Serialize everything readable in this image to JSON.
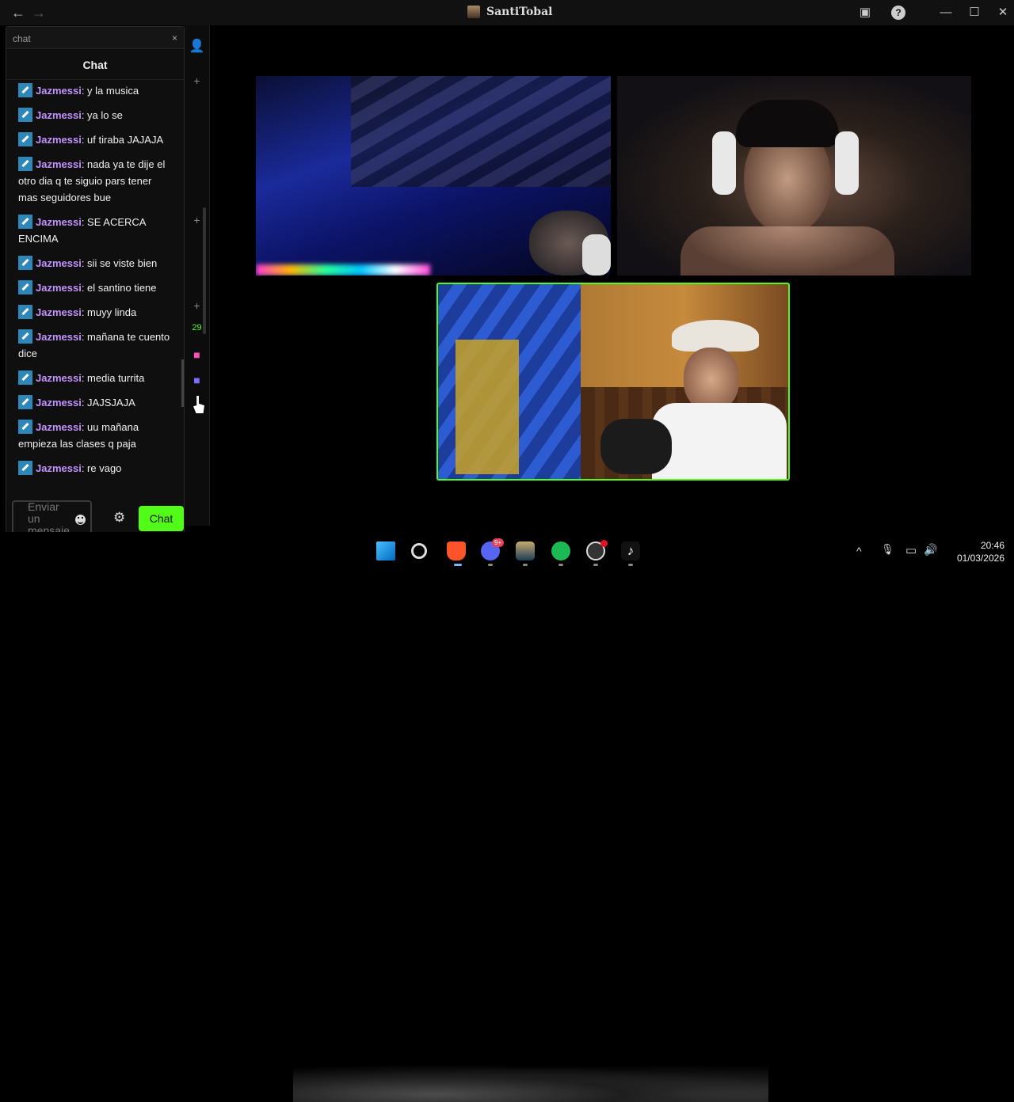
{
  "window": {
    "title": "SantiTobal",
    "back_icon": "←",
    "forward_icon": "→",
    "inbox_icon": "▣",
    "help_icon": "?",
    "minimize_icon": "—",
    "maximize_icon": "☐",
    "close_icon": "✕"
  },
  "popup": {
    "header": "chat",
    "close": "×"
  },
  "chat": {
    "title": "Chat",
    "messages": [
      {
        "user": "Jazmessi",
        "text": ": y la musica"
      },
      {
        "user": "Jazmessi",
        "text": ": ya lo se"
      },
      {
        "user": "Jazmessi",
        "text": ": uf tiraba JAJAJA"
      },
      {
        "user": "Jazmessi",
        "text": ": nada ya te dije el otro dia q te siguio pars tener mas seguidores bue"
      },
      {
        "user": "Jazmessi",
        "text": ": SE ACERCA ENCIMA"
      },
      {
        "user": "Jazmessi",
        "text": ": sii se viste bien"
      },
      {
        "user": "Jazmessi",
        "text": ": el santino tiene"
      },
      {
        "user": "Jazmessi",
        "text": ": muyy linda"
      },
      {
        "user": "Jazmessi",
        "text": ": mañana te cuento dice"
      },
      {
        "user": "Jazmessi",
        "text": ": media turrita"
      },
      {
        "user": "Jazmessi",
        "text": ": JAJSJAJA"
      },
      {
        "user": "Jazmessi",
        "text": ": uu mañana empieza las clases q paja"
      },
      {
        "user": "Jazmessi",
        "text": ": re vago"
      }
    ],
    "input_placeholder": "Enviar un mensaje",
    "settings_icon": "⚙",
    "send_label": "Chat"
  },
  "rail": {
    "add_friend_icon": "+",
    "count_badge": "29"
  },
  "taskbar": {
    "discord_badge": "9+",
    "time": "20:46",
    "date": "01/03/2026",
    "tray_chevron": "^",
    "mic_icon": "🎙",
    "network_icon": "▭",
    "volume_icon": "🔊"
  },
  "colors": {
    "accent": "#53fc18",
    "username": "#c493ff",
    "badge": "#2f86b8"
  }
}
